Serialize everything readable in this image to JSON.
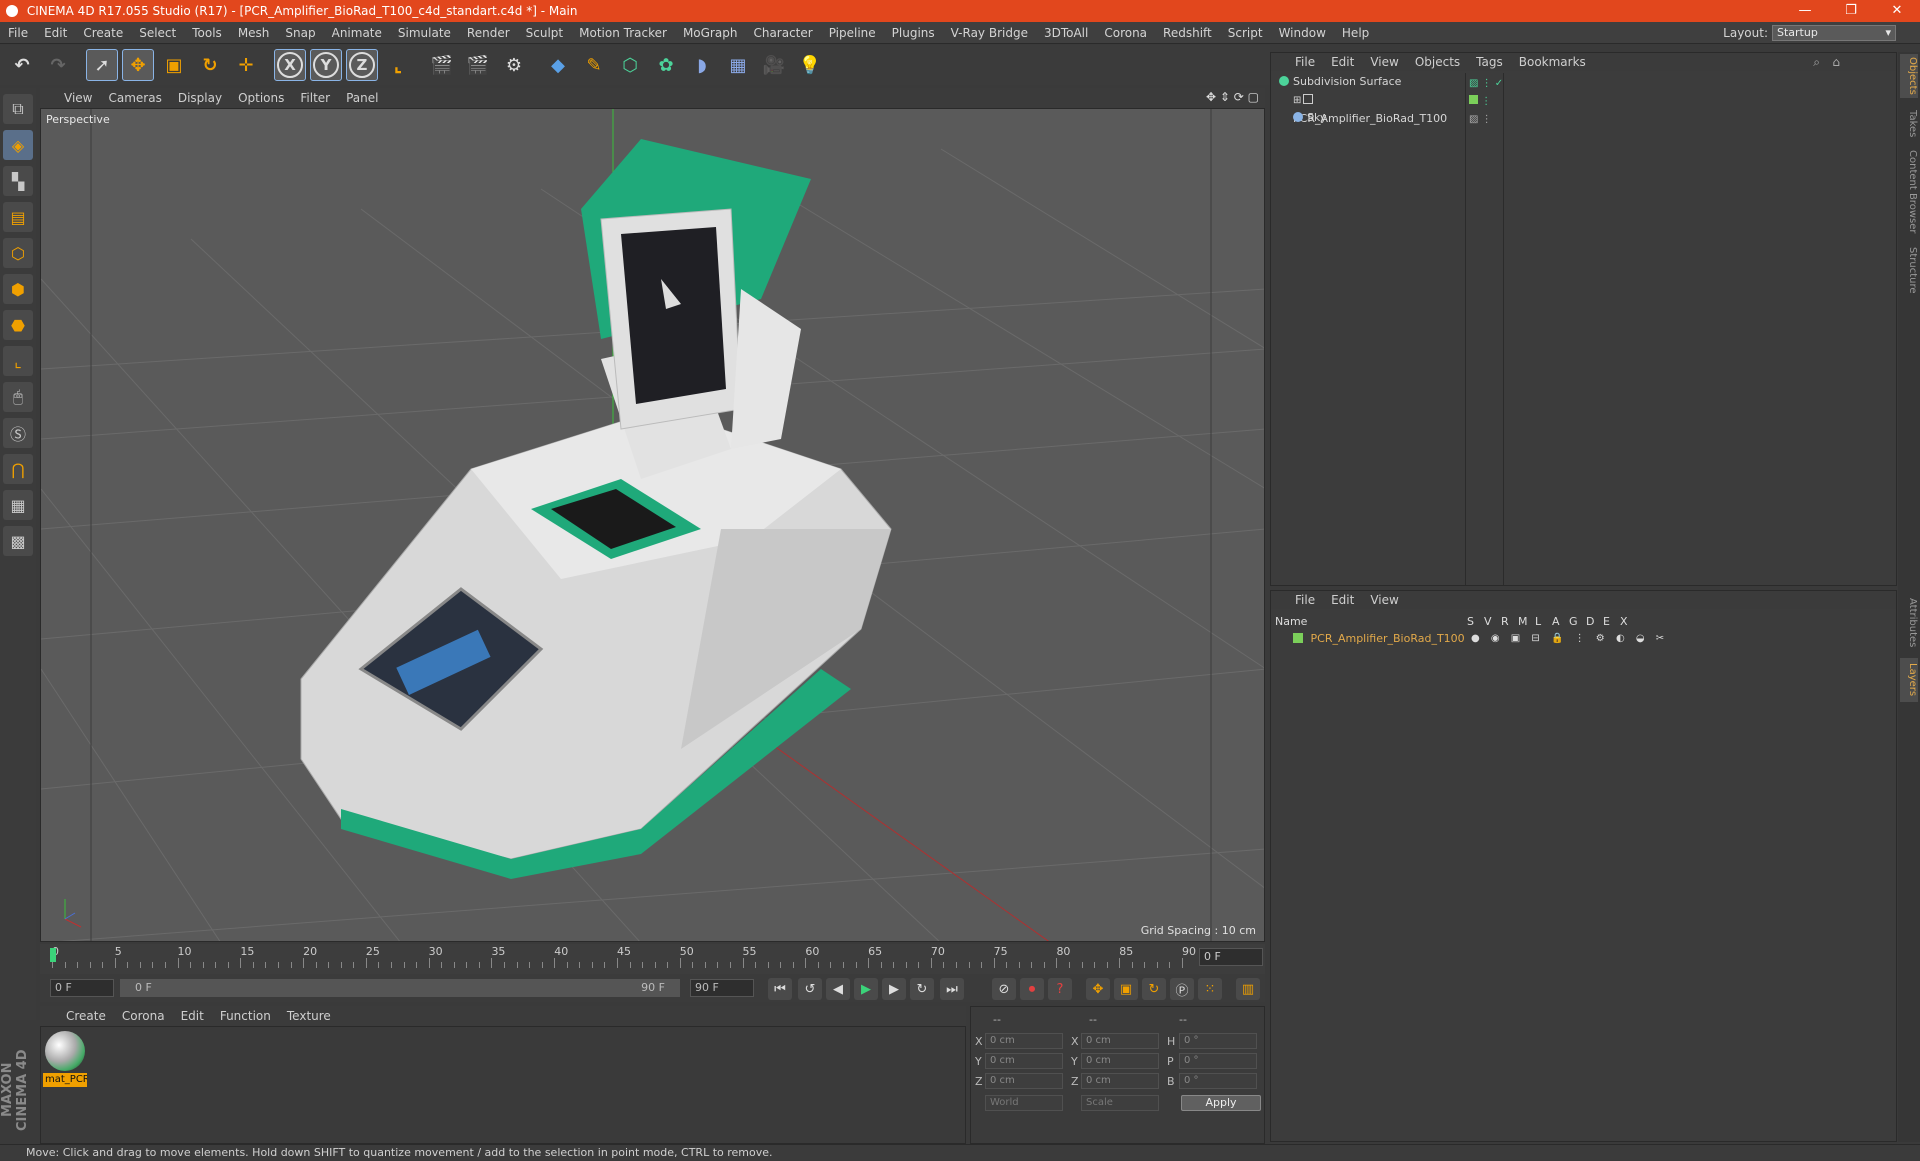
{
  "window": {
    "title": "CINEMA 4D R17.055 Studio (R17) - [PCR_Amplifier_BioRad_T100_c4d_standart.c4d *] - Main"
  },
  "menu": [
    "File",
    "Edit",
    "Create",
    "Select",
    "Tools",
    "Mesh",
    "Snap",
    "Animate",
    "Simulate",
    "Render",
    "Sculpt",
    "Motion Tracker",
    "MoGraph",
    "Character",
    "Pipeline",
    "Plugins",
    "V-Ray Bridge",
    "3DToAll",
    "Corona",
    "Redshift",
    "Script",
    "Window",
    "Help"
  ],
  "layout": {
    "label": "Layout:",
    "value": "Startup"
  },
  "viewport": {
    "menu": [
      "View",
      "Cameras",
      "Display",
      "Options",
      "Filter",
      "Panel"
    ],
    "label": "Perspective",
    "grid_spacing": "Grid Spacing : 10 cm"
  },
  "timeline": {
    "ticks": [
      "0",
      "5",
      "10",
      "15",
      "20",
      "25",
      "30",
      "35",
      "40",
      "45",
      "50",
      "55",
      "60",
      "65",
      "70",
      "75",
      "80",
      "85",
      "90"
    ],
    "frame": "0 F"
  },
  "transport": {
    "start": "0 F",
    "range_start": "0 F",
    "range_end": "90 F",
    "end": "90 F"
  },
  "material_manager": {
    "menu": [
      "Create",
      "Corona",
      "Edit",
      "Function",
      "Texture"
    ],
    "material_name": "mat_PCR"
  },
  "coords": {
    "header": [
      "--",
      "--",
      "--"
    ],
    "rows": [
      {
        "a": "X",
        "av": "0 cm",
        "b": "X",
        "bv": "0 cm",
        "c": "H",
        "cv": "0 °"
      },
      {
        "a": "Y",
        "av": "0 cm",
        "b": "Y",
        "bv": "0 cm",
        "c": "P",
        "cv": "0 °"
      },
      {
        "a": "Z",
        "av": "0 cm",
        "b": "Z",
        "bv": "0 cm",
        "c": "B",
        "cv": "0 °"
      }
    ],
    "world": "World",
    "scale": "Scale",
    "apply": "Apply"
  },
  "object_manager": {
    "menu": [
      "File",
      "Edit",
      "View",
      "Objects",
      "Tags",
      "Bookmarks"
    ],
    "objects": [
      "Subdivision Surface",
      "PCR_Amplifier_BioRad_T100",
      "Sky"
    ]
  },
  "layer_manager": {
    "menu": [
      "File",
      "Edit",
      "View"
    ],
    "headers": [
      "Name",
      "S",
      "V",
      "R",
      "M",
      "L",
      "A",
      "G",
      "D",
      "E",
      "X"
    ],
    "layer": "PCR_Amplifier_BioRad_T100"
  },
  "side_tabs": [
    "Objects",
    "Takes",
    "Content Browser",
    "Structure",
    "Attributes",
    "Layers"
  ],
  "status": "Move: Click and drag to move elements. Hold down SHIFT to quantize movement / add to the selection in point mode, CTRL to remove.",
  "brand": "MAXON CINEMA 4D",
  "colors": {
    "accent": "#e2471d",
    "model_green": "#1fa97a",
    "layer_name": "#e2a94a"
  }
}
